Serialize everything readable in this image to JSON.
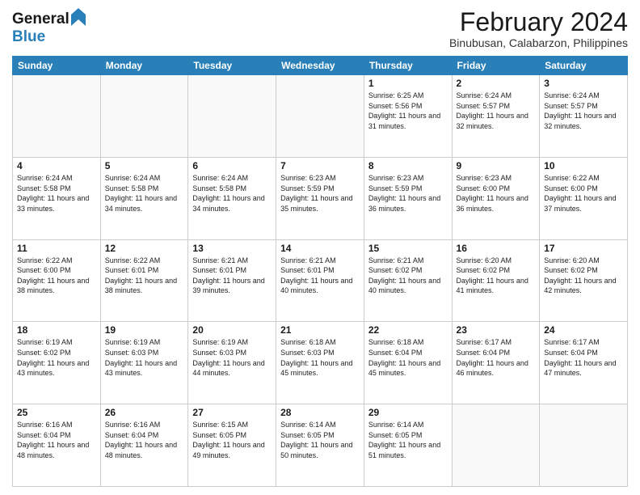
{
  "header": {
    "logo_line1": "General",
    "logo_line2": "Blue",
    "title": "February 2024",
    "subtitle": "Binubusan, Calabarzon, Philippines"
  },
  "weekdays": [
    "Sunday",
    "Monday",
    "Tuesday",
    "Wednesday",
    "Thursday",
    "Friday",
    "Saturday"
  ],
  "rows": [
    [
      {
        "day": "",
        "sunrise": "",
        "sunset": "",
        "daylight": ""
      },
      {
        "day": "",
        "sunrise": "",
        "sunset": "",
        "daylight": ""
      },
      {
        "day": "",
        "sunrise": "",
        "sunset": "",
        "daylight": ""
      },
      {
        "day": "",
        "sunrise": "",
        "sunset": "",
        "daylight": ""
      },
      {
        "day": "1",
        "sunrise": "Sunrise: 6:25 AM",
        "sunset": "Sunset: 5:56 PM",
        "daylight": "Daylight: 11 hours and 31 minutes."
      },
      {
        "day": "2",
        "sunrise": "Sunrise: 6:24 AM",
        "sunset": "Sunset: 5:57 PM",
        "daylight": "Daylight: 11 hours and 32 minutes."
      },
      {
        "day": "3",
        "sunrise": "Sunrise: 6:24 AM",
        "sunset": "Sunset: 5:57 PM",
        "daylight": "Daylight: 11 hours and 32 minutes."
      }
    ],
    [
      {
        "day": "4",
        "sunrise": "Sunrise: 6:24 AM",
        "sunset": "Sunset: 5:58 PM",
        "daylight": "Daylight: 11 hours and 33 minutes."
      },
      {
        "day": "5",
        "sunrise": "Sunrise: 6:24 AM",
        "sunset": "Sunset: 5:58 PM",
        "daylight": "Daylight: 11 hours and 34 minutes."
      },
      {
        "day": "6",
        "sunrise": "Sunrise: 6:24 AM",
        "sunset": "Sunset: 5:58 PM",
        "daylight": "Daylight: 11 hours and 34 minutes."
      },
      {
        "day": "7",
        "sunrise": "Sunrise: 6:23 AM",
        "sunset": "Sunset: 5:59 PM",
        "daylight": "Daylight: 11 hours and 35 minutes."
      },
      {
        "day": "8",
        "sunrise": "Sunrise: 6:23 AM",
        "sunset": "Sunset: 5:59 PM",
        "daylight": "Daylight: 11 hours and 36 minutes."
      },
      {
        "day": "9",
        "sunrise": "Sunrise: 6:23 AM",
        "sunset": "Sunset: 6:00 PM",
        "daylight": "Daylight: 11 hours and 36 minutes."
      },
      {
        "day": "10",
        "sunrise": "Sunrise: 6:22 AM",
        "sunset": "Sunset: 6:00 PM",
        "daylight": "Daylight: 11 hours and 37 minutes."
      }
    ],
    [
      {
        "day": "11",
        "sunrise": "Sunrise: 6:22 AM",
        "sunset": "Sunset: 6:00 PM",
        "daylight": "Daylight: 11 hours and 38 minutes."
      },
      {
        "day": "12",
        "sunrise": "Sunrise: 6:22 AM",
        "sunset": "Sunset: 6:01 PM",
        "daylight": "Daylight: 11 hours and 38 minutes."
      },
      {
        "day": "13",
        "sunrise": "Sunrise: 6:21 AM",
        "sunset": "Sunset: 6:01 PM",
        "daylight": "Daylight: 11 hours and 39 minutes."
      },
      {
        "day": "14",
        "sunrise": "Sunrise: 6:21 AM",
        "sunset": "Sunset: 6:01 PM",
        "daylight": "Daylight: 11 hours and 40 minutes."
      },
      {
        "day": "15",
        "sunrise": "Sunrise: 6:21 AM",
        "sunset": "Sunset: 6:02 PM",
        "daylight": "Daylight: 11 hours and 40 minutes."
      },
      {
        "day": "16",
        "sunrise": "Sunrise: 6:20 AM",
        "sunset": "Sunset: 6:02 PM",
        "daylight": "Daylight: 11 hours and 41 minutes."
      },
      {
        "day": "17",
        "sunrise": "Sunrise: 6:20 AM",
        "sunset": "Sunset: 6:02 PM",
        "daylight": "Daylight: 11 hours and 42 minutes."
      }
    ],
    [
      {
        "day": "18",
        "sunrise": "Sunrise: 6:19 AM",
        "sunset": "Sunset: 6:02 PM",
        "daylight": "Daylight: 11 hours and 43 minutes."
      },
      {
        "day": "19",
        "sunrise": "Sunrise: 6:19 AM",
        "sunset": "Sunset: 6:03 PM",
        "daylight": "Daylight: 11 hours and 43 minutes."
      },
      {
        "day": "20",
        "sunrise": "Sunrise: 6:19 AM",
        "sunset": "Sunset: 6:03 PM",
        "daylight": "Daylight: 11 hours and 44 minutes."
      },
      {
        "day": "21",
        "sunrise": "Sunrise: 6:18 AM",
        "sunset": "Sunset: 6:03 PM",
        "daylight": "Daylight: 11 hours and 45 minutes."
      },
      {
        "day": "22",
        "sunrise": "Sunrise: 6:18 AM",
        "sunset": "Sunset: 6:04 PM",
        "daylight": "Daylight: 11 hours and 45 minutes."
      },
      {
        "day": "23",
        "sunrise": "Sunrise: 6:17 AM",
        "sunset": "Sunset: 6:04 PM",
        "daylight": "Daylight: 11 hours and 46 minutes."
      },
      {
        "day": "24",
        "sunrise": "Sunrise: 6:17 AM",
        "sunset": "Sunset: 6:04 PM",
        "daylight": "Daylight: 11 hours and 47 minutes."
      }
    ],
    [
      {
        "day": "25",
        "sunrise": "Sunrise: 6:16 AM",
        "sunset": "Sunset: 6:04 PM",
        "daylight": "Daylight: 11 hours and 48 minutes."
      },
      {
        "day": "26",
        "sunrise": "Sunrise: 6:16 AM",
        "sunset": "Sunset: 6:04 PM",
        "daylight": "Daylight: 11 hours and 48 minutes."
      },
      {
        "day": "27",
        "sunrise": "Sunrise: 6:15 AM",
        "sunset": "Sunset: 6:05 PM",
        "daylight": "Daylight: 11 hours and 49 minutes."
      },
      {
        "day": "28",
        "sunrise": "Sunrise: 6:14 AM",
        "sunset": "Sunset: 6:05 PM",
        "daylight": "Daylight: 11 hours and 50 minutes."
      },
      {
        "day": "29",
        "sunrise": "Sunrise: 6:14 AM",
        "sunset": "Sunset: 6:05 PM",
        "daylight": "Daylight: 11 hours and 51 minutes."
      },
      {
        "day": "",
        "sunrise": "",
        "sunset": "",
        "daylight": ""
      },
      {
        "day": "",
        "sunrise": "",
        "sunset": "",
        "daylight": ""
      }
    ]
  ]
}
